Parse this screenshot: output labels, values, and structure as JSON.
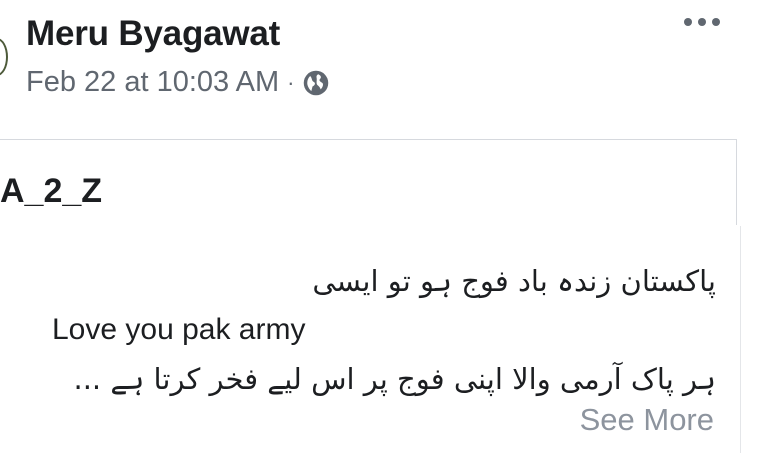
{
  "post": {
    "author": "Meru Byagawat",
    "timestamp": "Feb 22 at 10:03 AM",
    "separator": "·",
    "privacy_icon": "globe-icon",
    "menu_icon": "more-options-icon"
  },
  "shared": {
    "title": "A_2_Z",
    "lines": [
      "پاکستان زندہ باد فوج ہو تو ایسی",
      "Love you pak army",
      "ہر پاک آرمی والا اپنی فوج پر اس لیے فخر کرتا ہے ..."
    ],
    "see_more": "See More"
  },
  "colors": {
    "secondary_text": "#606770",
    "see_more": "#8d949e",
    "border": "#d6d9de"
  }
}
